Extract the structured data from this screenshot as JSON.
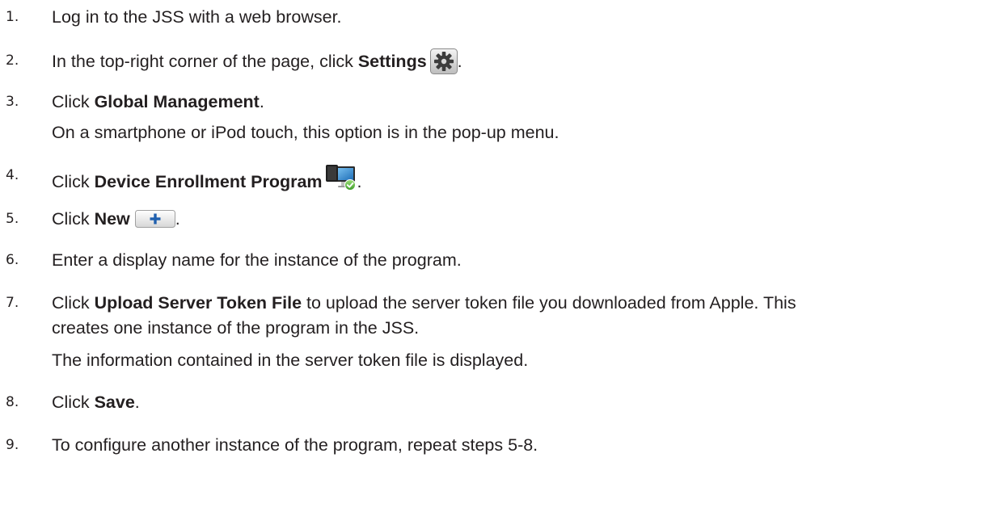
{
  "steps": [
    {
      "num": "1.",
      "before": "Log in to the JSS with a web browser.",
      "bold": "",
      "after": ""
    },
    {
      "num": "2.",
      "before": "In the top-right corner of the page, click ",
      "bold": "Settings",
      "after": "."
    },
    {
      "num": "3.",
      "before": "Click ",
      "bold": "Global Management",
      "after": ".",
      "note": "On a smartphone or iPod touch, this option is in the pop-up menu."
    },
    {
      "num": "4.",
      "before": "Click ",
      "bold": "Device Enrollment Program",
      "after": "."
    },
    {
      "num": "5.",
      "before": "Click ",
      "bold": "New",
      "after": "."
    },
    {
      "num": "6.",
      "before": "Enter a display name for the instance of the program.",
      "bold": "",
      "after": ""
    },
    {
      "num": "7.",
      "before": "Click ",
      "bold": "Upload Server Token File",
      "after": " to upload the server token file you downloaded from Apple. This",
      "line2": "creates one instance of the program in the JSS.",
      "note": "The information contained in the server token file is displayed."
    },
    {
      "num": "8.",
      "before": "Click ",
      "bold": "Save",
      "after": "."
    },
    {
      "num": "9.",
      "before": "To configure another instance of the program, repeat steps 5-8.",
      "bold": "",
      "after": ""
    }
  ],
  "icons": {
    "settings": "gear-icon",
    "device_enrollment": "device-enrollment-icon",
    "new": "plus-icon"
  },
  "colors": {
    "text": "#231f20",
    "plus_blue": "#1f5fae"
  }
}
